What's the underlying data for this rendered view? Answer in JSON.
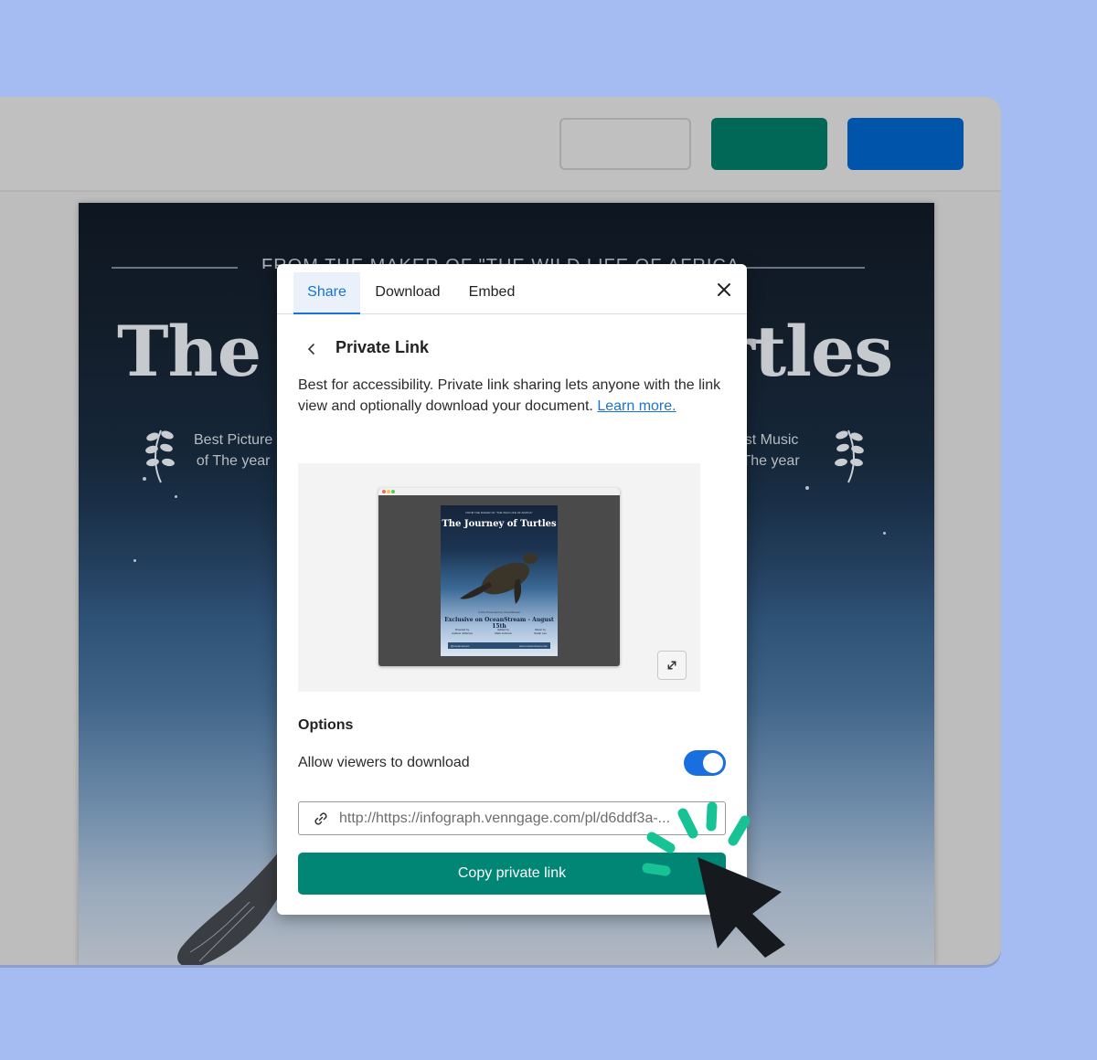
{
  "app": {
    "header_buttons": [
      {
        "name": "outline-button",
        "label": ""
      },
      {
        "name": "green-button",
        "label": ""
      },
      {
        "name": "blue-button",
        "label": ""
      }
    ],
    "colors": {
      "background": "#a5bcf3",
      "header_green": "#016757",
      "header_blue": "#0055aa",
      "primary_teal": "#018574",
      "link_blue": "#1a73d1",
      "toggle_blue": "#1a6fe0",
      "sparkle_green": "#17c394"
    }
  },
  "poster": {
    "kicker": "FROM THE MAKER OF \"THE WILD LIFE OF AFRICA\"",
    "title_left": "The",
    "title_right": "rtles",
    "awards": [
      {
        "line1": "Best Picture",
        "line2": "of The year"
      },
      {
        "line1": "Best Music",
        "line2": "of The year"
      }
    ]
  },
  "modal": {
    "tabs": [
      {
        "label": "Share",
        "active": true
      },
      {
        "label": "Download",
        "active": false
      },
      {
        "label": "Embed",
        "active": false
      }
    ],
    "close_icon": "close-icon",
    "back_icon": "chevron-left-icon",
    "section_title": "Private Link",
    "description": "Best for accessibility. Private link sharing lets anyone with the link view and optionally download your document.",
    "learn_more": "Learn more.",
    "preview": {
      "mini_kicker": "FROM THE MAKER OF \"THE WILD LIFE OF AFRICA\"",
      "mini_title": "The Journey of Turtles",
      "mini_tagline": "A Film Presented by OceanStream",
      "mini_subtitle": "Exclusive on OceanStream - August 15th",
      "mini_credits": [
        {
          "role": "Directed by",
          "name": "Andrew Jefferson"
        },
        {
          "role": "Edited by",
          "name": "Mark Johnson"
        },
        {
          "role": "Music by",
          "name": "Sarah Lee"
        }
      ],
      "mini_footer_left": "@oceanstream",
      "mini_footer_right": "www.oceanstream.com",
      "expand_icon": "expand-icon"
    },
    "options_title": "Options",
    "allow_download_label": "Allow viewers to download",
    "allow_download": true,
    "link_icon": "link-icon",
    "link_value": "http://https://infograph.venngage.com/pl/d6ddf3a-...",
    "copy_button_label": "Copy private link"
  }
}
